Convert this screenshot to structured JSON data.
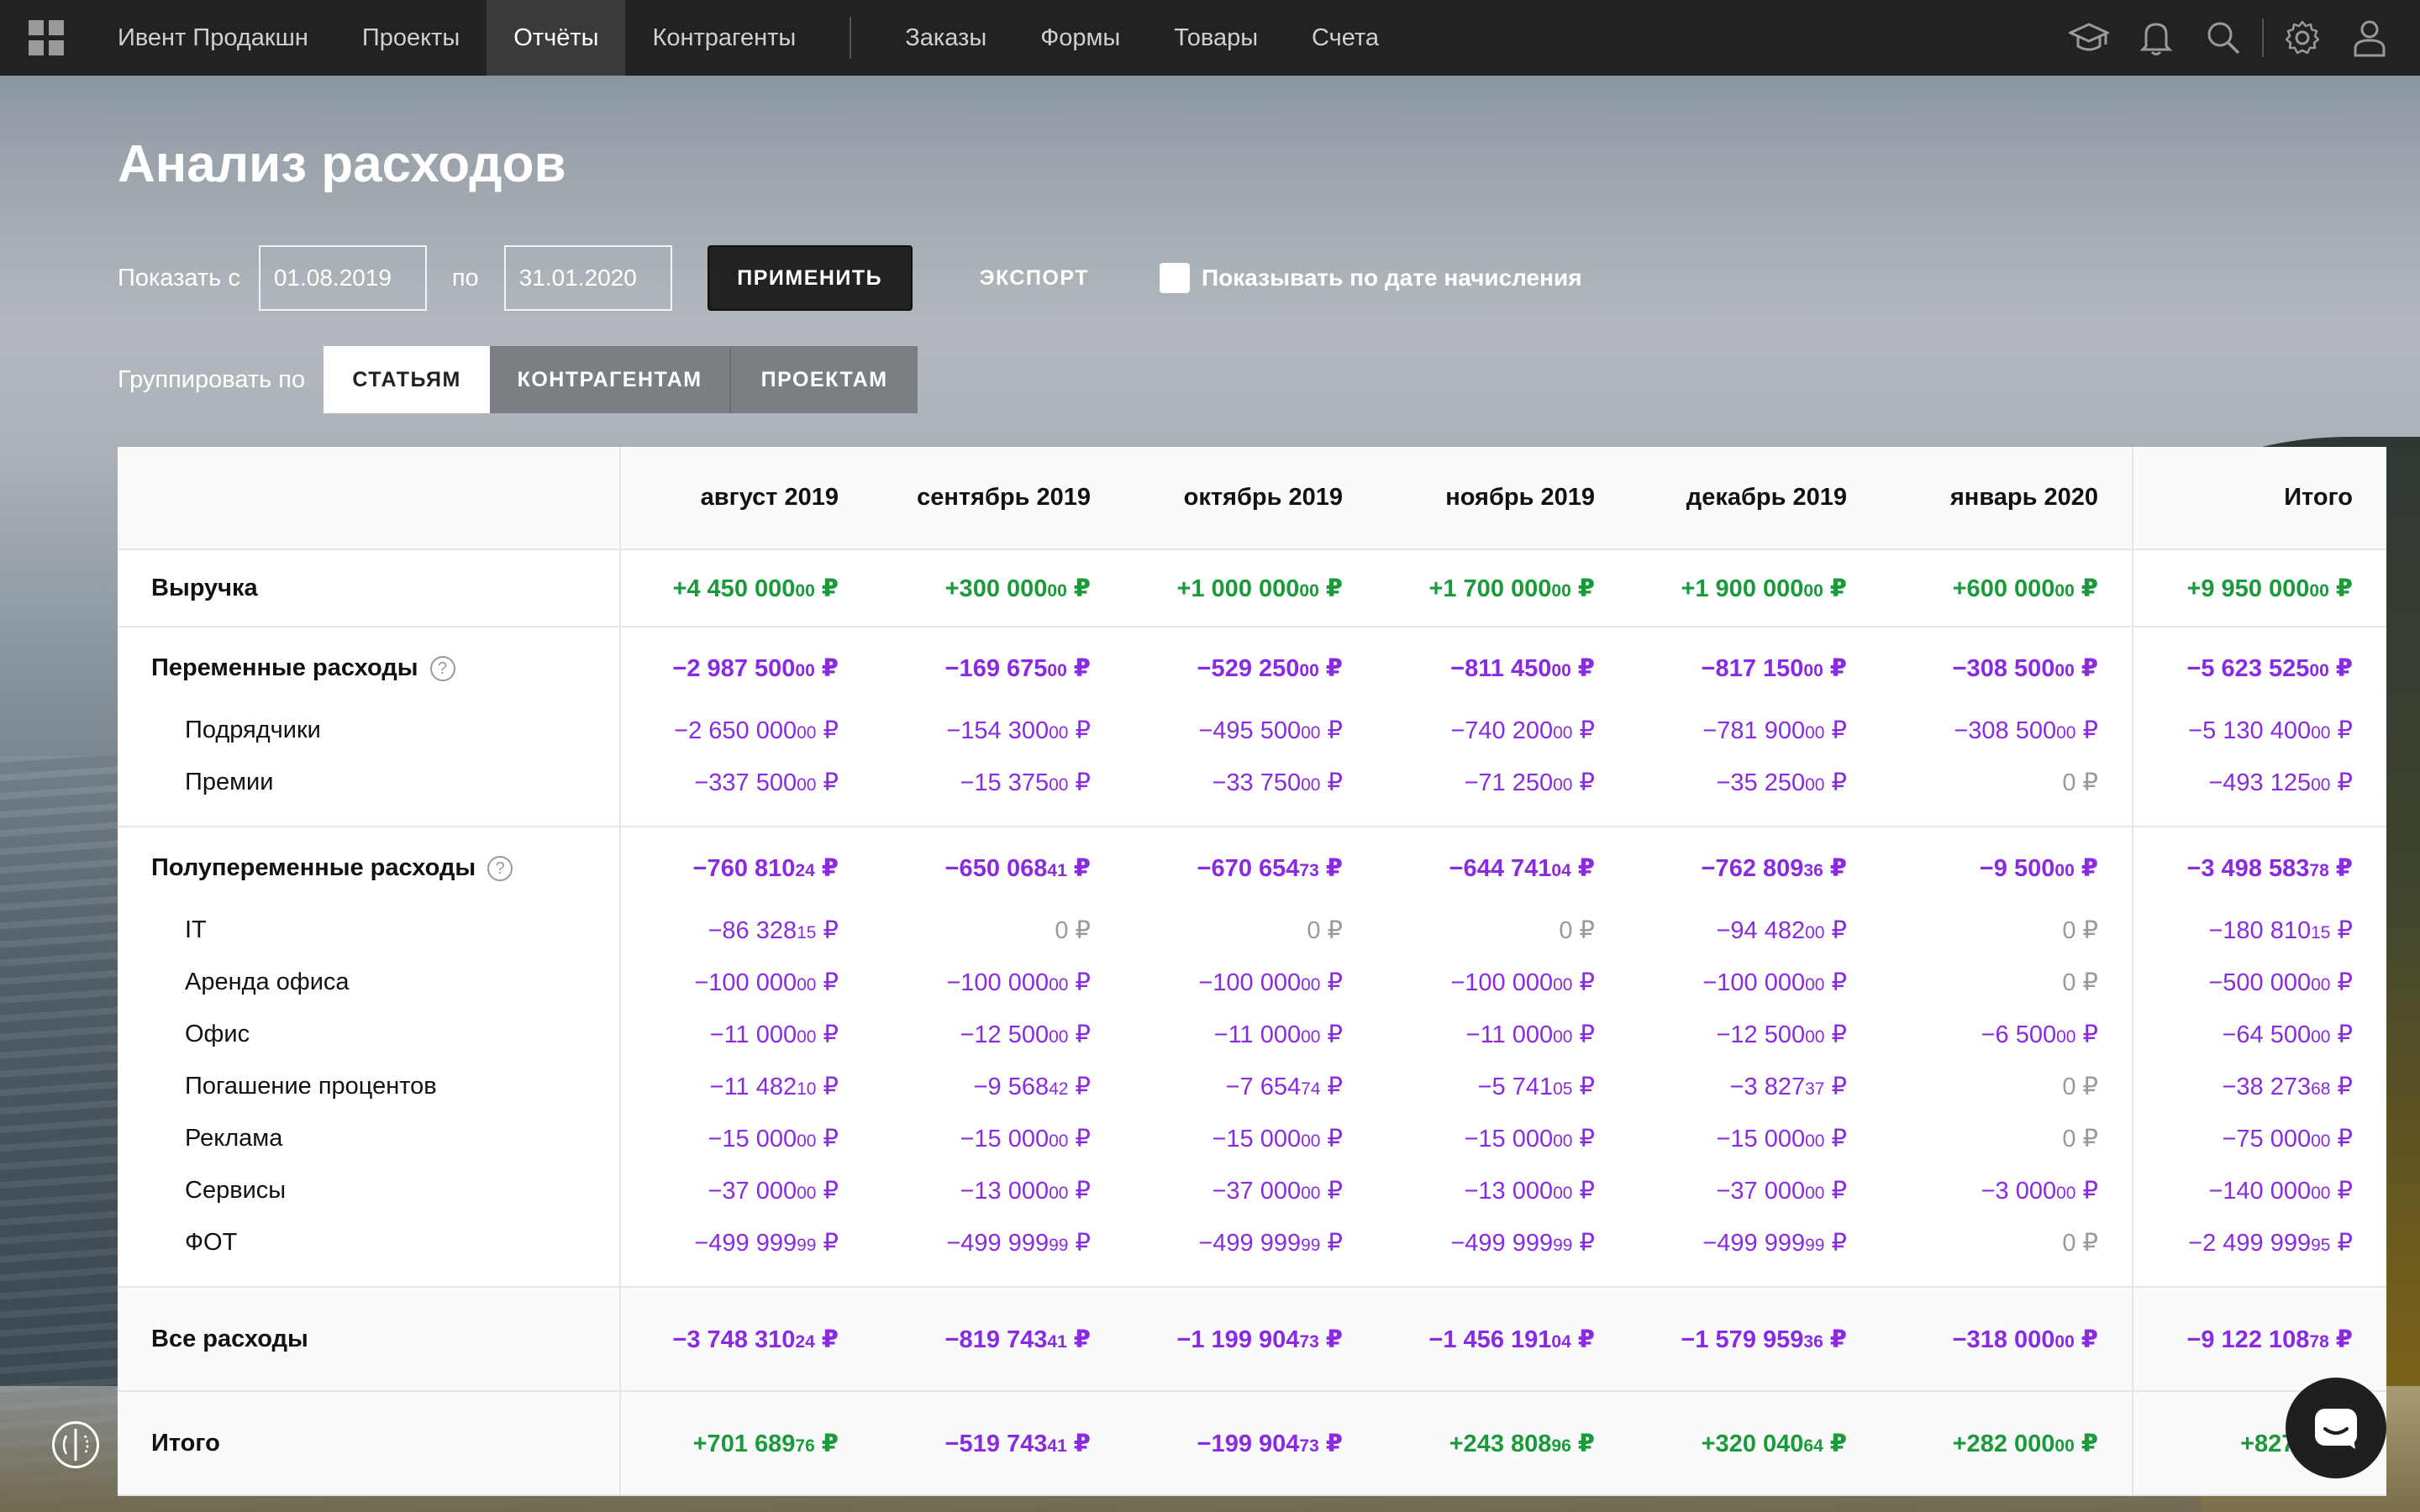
{
  "nav": {
    "company": "Ивент Продакшн",
    "items": [
      "Проекты",
      "Отчёты",
      "Контрагенты"
    ],
    "items2": [
      "Заказы",
      "Формы",
      "Товары",
      "Счета"
    ],
    "active": "Отчёты",
    "icons": [
      "apps-grid-icon",
      "academy-cap-icon",
      "bell-icon",
      "search-icon",
      "gear-icon",
      "user-icon"
    ]
  },
  "page": {
    "title": "Анализ расходов"
  },
  "filters": {
    "from_label": "Показать с",
    "from_value": "01.08.2019",
    "to_label": "по",
    "to_value": "31.01.2020",
    "apply": "ПРИМЕНИТЬ",
    "export": "ЭКСПОРТ",
    "accrual_label": "Показывать по дате начисления"
  },
  "grouping": {
    "label": "Группировать по",
    "options": [
      "СТАТЬЯМ",
      "КОНТРАГЕНТАМ",
      "ПРОЕКТАМ"
    ],
    "selected": "СТАТЬЯМ"
  },
  "table": {
    "columns": [
      "август 2019",
      "сентябрь 2019",
      "октябрь 2019",
      "ноябрь 2019",
      "декабрь 2019",
      "январь 2020",
      "Итого"
    ],
    "revenue": {
      "label": "Выручка",
      "values": [
        [
          "+4 450 000",
          "00"
        ],
        [
          "+300 000",
          "00"
        ],
        [
          "+1 000 000",
          "00"
        ],
        [
          "+1 700 000",
          "00"
        ],
        [
          "+1 900 000",
          "00"
        ],
        [
          "+600 000",
          "00"
        ],
        [
          "+9 950 000",
          "00"
        ]
      ]
    },
    "variable": {
      "label": "Переменные расходы",
      "values": [
        [
          "−2 987 500",
          "00"
        ],
        [
          "−169 675",
          "00"
        ],
        [
          "−529 250",
          "00"
        ],
        [
          "−811 450",
          "00"
        ],
        [
          "−817 150",
          "00"
        ],
        [
          "−308 500",
          "00"
        ],
        [
          "−5 623 525",
          "00"
        ]
      ],
      "items": [
        {
          "label": "Подрядчики",
          "values": [
            [
              "−2 650 000",
              "00"
            ],
            [
              "−154 300",
              "00"
            ],
            [
              "−495 500",
              "00"
            ],
            [
              "−740 200",
              "00"
            ],
            [
              "−781 900",
              "00"
            ],
            [
              "−308 500",
              "00"
            ],
            [
              "−5 130 400",
              "00"
            ]
          ]
        },
        {
          "label": "Премии",
          "values": [
            [
              "−337 500",
              "00"
            ],
            [
              "−15 375",
              "00"
            ],
            [
              "−33 750",
              "00"
            ],
            [
              "−71 250",
              "00"
            ],
            [
              "−35 250",
              "00"
            ],
            [
              "0",
              ""
            ],
            [
              "−493 125",
              "00"
            ]
          ]
        }
      ]
    },
    "semi": {
      "label": "Полупеременные расходы",
      "values": [
        [
          "−760 810",
          "24"
        ],
        [
          "−650 068",
          "41"
        ],
        [
          "−670 654",
          "73"
        ],
        [
          "−644 741",
          "04"
        ],
        [
          "−762 809",
          "36"
        ],
        [
          "−9 500",
          "00"
        ],
        [
          "−3 498 583",
          "78"
        ]
      ],
      "items": [
        {
          "label": "IT",
          "values": [
            [
              "−86 328",
              "15"
            ],
            [
              "0",
              ""
            ],
            [
              "0",
              ""
            ],
            [
              "0",
              ""
            ],
            [
              "−94 482",
              "00"
            ],
            [
              "0",
              ""
            ],
            [
              "−180 810",
              "15"
            ]
          ]
        },
        {
          "label": "Аренда офиса",
          "values": [
            [
              "−100 000",
              "00"
            ],
            [
              "−100 000",
              "00"
            ],
            [
              "−100 000",
              "00"
            ],
            [
              "−100 000",
              "00"
            ],
            [
              "−100 000",
              "00"
            ],
            [
              "0",
              ""
            ],
            [
              "−500 000",
              "00"
            ]
          ]
        },
        {
          "label": "Офис",
          "values": [
            [
              "−11 000",
              "00"
            ],
            [
              "−12 500",
              "00"
            ],
            [
              "−11 000",
              "00"
            ],
            [
              "−11 000",
              "00"
            ],
            [
              "−12 500",
              "00"
            ],
            [
              "−6 500",
              "00"
            ],
            [
              "−64 500",
              "00"
            ]
          ]
        },
        {
          "label": "Погашение процентов",
          "values": [
            [
              "−11 482",
              "10"
            ],
            [
              "−9 568",
              "42"
            ],
            [
              "−7 654",
              "74"
            ],
            [
              "−5 741",
              "05"
            ],
            [
              "−3 827",
              "37"
            ],
            [
              "0",
              ""
            ],
            [
              "−38 273",
              "68"
            ]
          ]
        },
        {
          "label": "Реклама",
          "values": [
            [
              "−15 000",
              "00"
            ],
            [
              "−15 000",
              "00"
            ],
            [
              "−15 000",
              "00"
            ],
            [
              "−15 000",
              "00"
            ],
            [
              "−15 000",
              "00"
            ],
            [
              "0",
              ""
            ],
            [
              "−75 000",
              "00"
            ]
          ]
        },
        {
          "label": "Сервисы",
          "values": [
            [
              "−37 000",
              "00"
            ],
            [
              "−13 000",
              "00"
            ],
            [
              "−37 000",
              "00"
            ],
            [
              "−13 000",
              "00"
            ],
            [
              "−37 000",
              "00"
            ],
            [
              "−3 000",
              "00"
            ],
            [
              "−140 000",
              "00"
            ]
          ]
        },
        {
          "label": "ФОТ",
          "values": [
            [
              "−499 999",
              "99"
            ],
            [
              "−499 999",
              "99"
            ],
            [
              "−499 999",
              "99"
            ],
            [
              "−499 999",
              "99"
            ],
            [
              "−499 999",
              "99"
            ],
            [
              "0",
              ""
            ],
            [
              "−2 499 999",
              "95"
            ]
          ]
        }
      ]
    },
    "all_expenses": {
      "label": "Все расходы",
      "values": [
        [
          "−3 748 310",
          "24"
        ],
        [
          "−819 743",
          "41"
        ],
        [
          "−1 199 904",
          "73"
        ],
        [
          "−1 456 191",
          "04"
        ],
        [
          "−1 579 959",
          "36"
        ],
        [
          "−318 000",
          "00"
        ],
        [
          "−9 122 108",
          "78"
        ]
      ]
    },
    "total": {
      "label": "Итого",
      "values": [
        [
          "+701 689",
          "76"
        ],
        [
          "−519 743",
          "41"
        ],
        [
          "−199 904",
          "73"
        ],
        [
          "+243 808",
          "96"
        ],
        [
          "+320 040",
          "64"
        ],
        [
          "+282 000",
          "00"
        ],
        [
          "+827 89",
          ""
        ]
      ]
    },
    "currency": "₽"
  },
  "colors": {
    "positive": "#1a9a3a",
    "negative": "#8a2be2",
    "zero": "#9a9a9a",
    "nav_bg": "#222222"
  }
}
